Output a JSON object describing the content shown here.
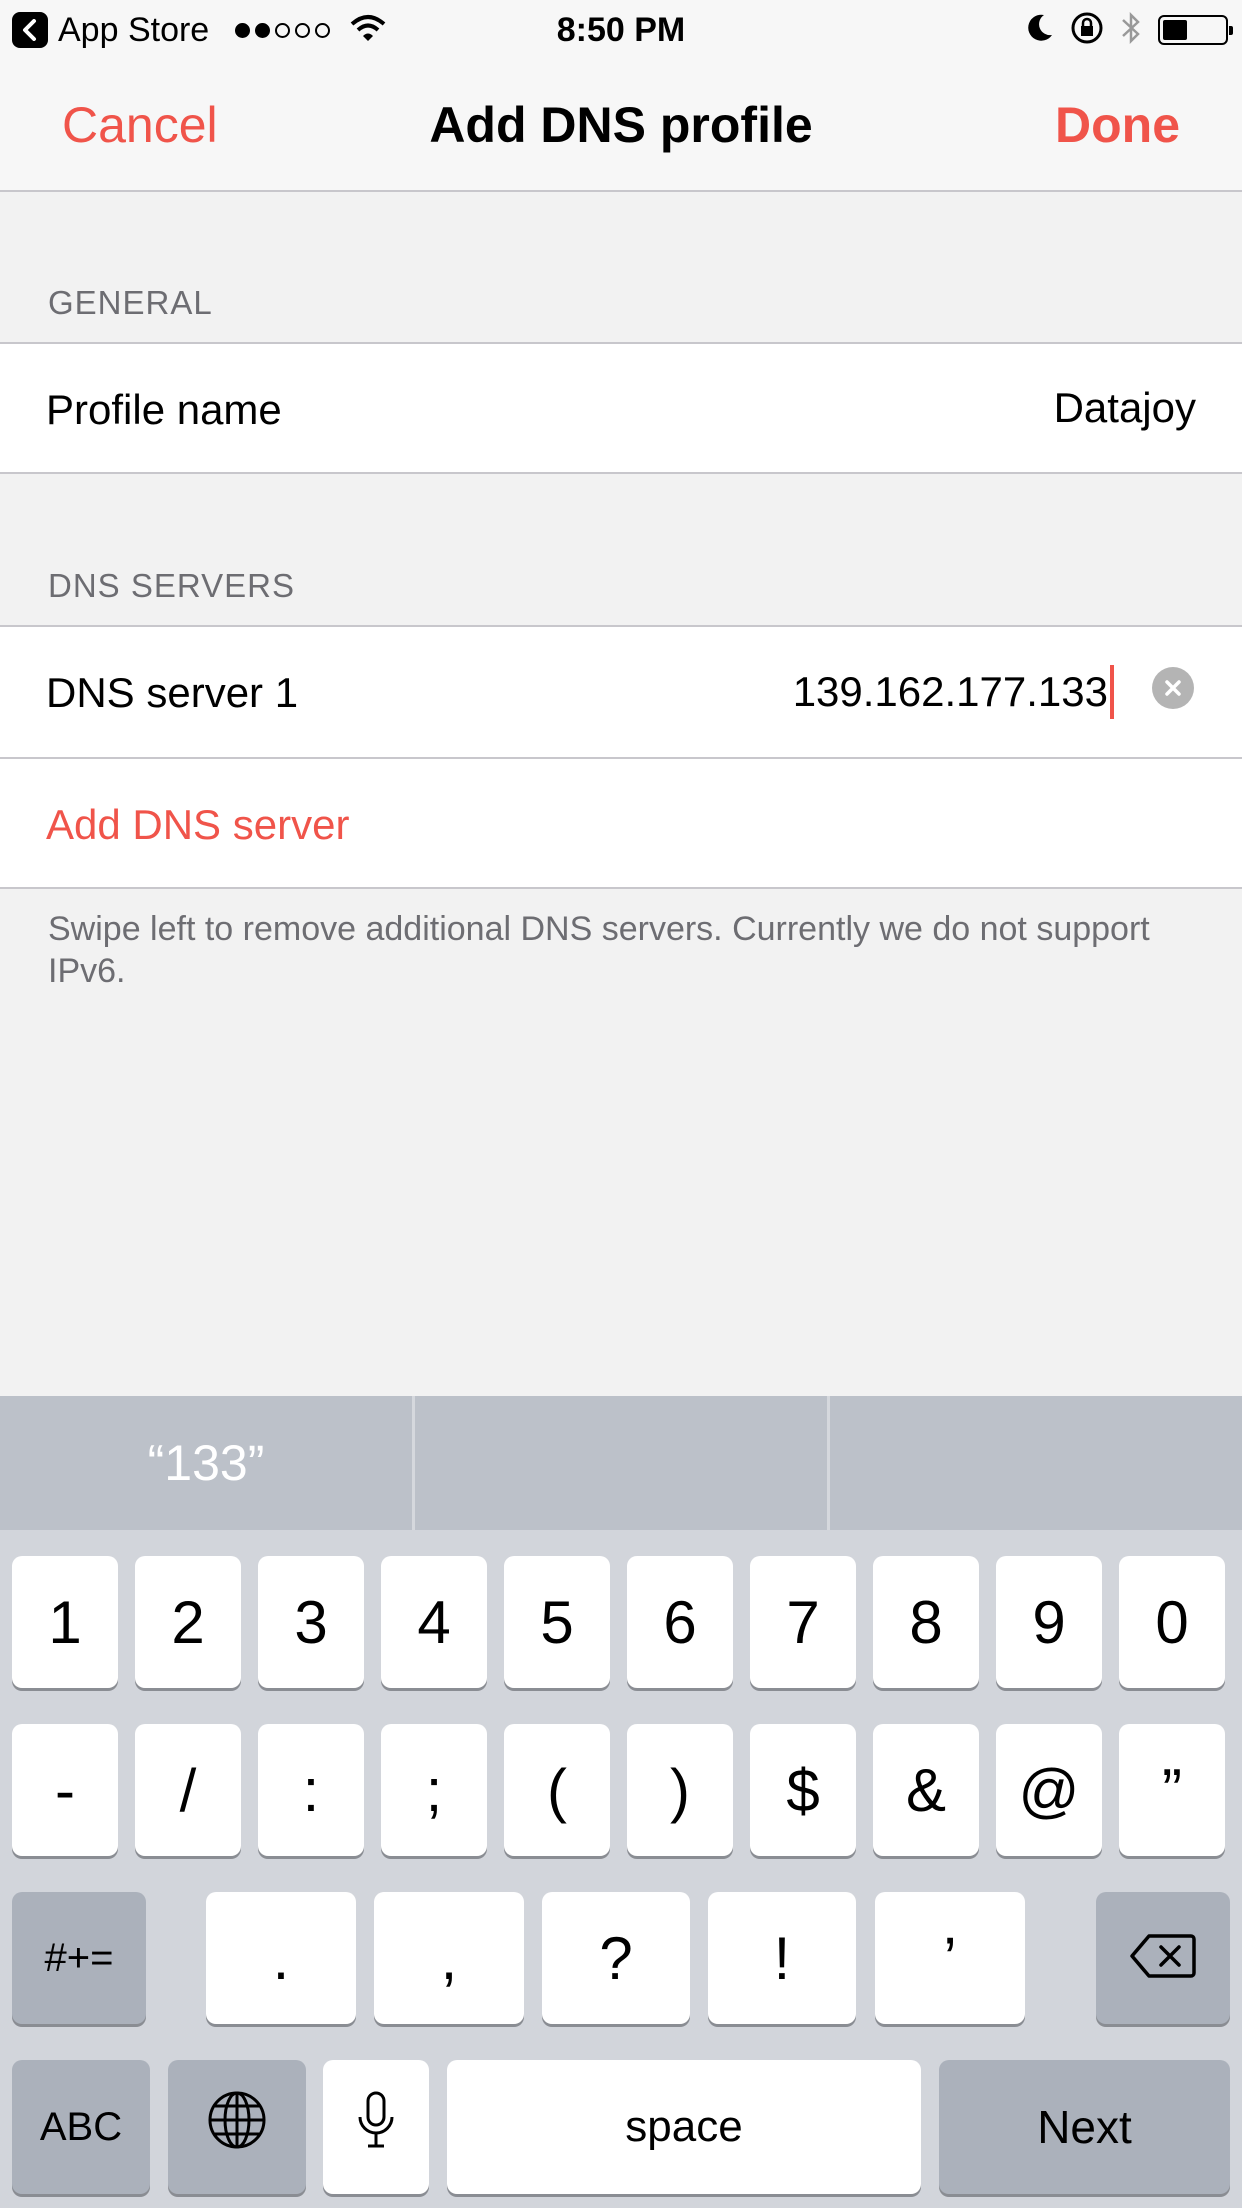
{
  "status_bar": {
    "back_app": "App Store",
    "time": "8:50 PM"
  },
  "nav": {
    "cancel": "Cancel",
    "title": "Add DNS profile",
    "done": "Done"
  },
  "general": {
    "header": "GENERAL",
    "profile_label": "Profile name",
    "profile_value": "Datajoy"
  },
  "dns": {
    "header": "DNS SERVERS",
    "server1_label": "DNS server 1",
    "server1_value": "139.162.177.133",
    "add_label": "Add DNS server",
    "footer": "Swipe left to remove additional DNS servers. Currently we do not support IPv6."
  },
  "keyboard": {
    "suggestions": [
      "“133”",
      "",
      ""
    ],
    "row1": [
      "1",
      "2",
      "3",
      "4",
      "5",
      "6",
      "7",
      "8",
      "9",
      "0"
    ],
    "row2": [
      "-",
      "/",
      ":",
      ";",
      "(",
      ")",
      "$",
      "&",
      "@",
      "”"
    ],
    "row3_shift": "#+=",
    "row3": [
      ".",
      ",",
      "?",
      "!",
      "’"
    ],
    "abc": "ABC",
    "space": "space",
    "next": "Next"
  },
  "colors": {
    "accent": "#f0544a",
    "keyboard_bg": "#d2d5db"
  }
}
